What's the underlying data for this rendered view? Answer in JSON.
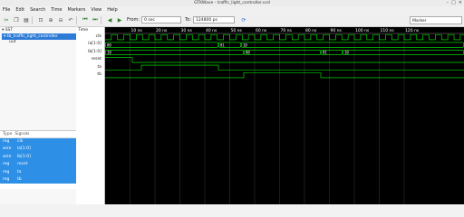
{
  "window": {
    "title": "GTKWave - traffic_light_controller.vcd",
    "minimize": "–",
    "maximize": "□",
    "close": "×"
  },
  "menu": [
    "File",
    "Edit",
    "Search",
    "Time",
    "Markers",
    "View",
    "Help"
  ],
  "toolbar": {
    "from_label": "From:",
    "from_value": "0 sec",
    "to_label": "To:",
    "to_value": "124800 ps",
    "marker_value": "Marker"
  },
  "sst": {
    "header": "SST",
    "tree_top": "tb_traffic_light_controller",
    "tree_child": "uut"
  },
  "signals_panel": {
    "col_type": "Type",
    "col_signals": "Signals",
    "rows": [
      {
        "type": "reg",
        "name": "clk"
      },
      {
        "type": "wire",
        "name": "la[1:0]"
      },
      {
        "type": "wire",
        "name": "lb[1:0]"
      },
      {
        "type": "reg",
        "name": "reset"
      },
      {
        "type": "reg",
        "name": "ta"
      },
      {
        "type": "reg",
        "name": "tb"
      }
    ]
  },
  "names_panel": {
    "header": "Time",
    "signals": [
      "clk",
      "la[1:0]",
      "lb[1:0]",
      "reset",
      "ta",
      "tb"
    ]
  },
  "waveform": {
    "time_ticks": [
      "10 ns",
      "20 ns",
      "30 ns",
      "40 ns",
      "50 ns",
      "60 ns",
      "70 ns",
      "80 ns",
      "90 ns",
      "100 ns",
      "110 ns",
      "120 ns"
    ],
    "la_values": [
      "00",
      "01",
      "10"
    ],
    "lb_values": [
      "10",
      "00",
      "01",
      "10"
    ],
    "signal_color": "#00ff00",
    "grid_color": "#3a3a3a"
  }
}
